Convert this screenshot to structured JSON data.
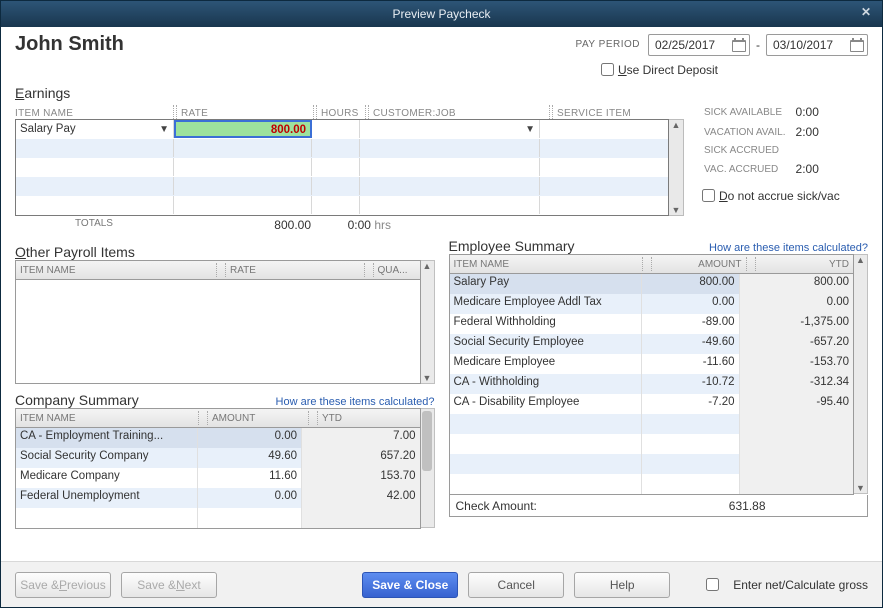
{
  "window": {
    "title": "Preview Paycheck"
  },
  "employee": {
    "name": "John Smith"
  },
  "pay_period": {
    "label": "PAY PERIOD",
    "start": "02/25/2017",
    "to": "-",
    "end": "03/10/2017"
  },
  "direct_deposit": {
    "checked": false,
    "label": "Use Direct Deposit",
    "underline_char": "U"
  },
  "earnings": {
    "title": "Earnings",
    "title_underline": "E",
    "columns": {
      "item": "ITEM NAME",
      "rate": "RATE",
      "hours": "HOURS",
      "customer": "CUSTOMER:JOB",
      "service": "SERVICE ITEM"
    },
    "rows": [
      {
        "item": "Salary Pay",
        "rate": "800.00",
        "hours": "",
        "customer": "",
        "service": ""
      }
    ],
    "totals": {
      "label": "TOTALS",
      "rate": "800.00",
      "hours": "0:00",
      "hrs_suffix": "hrs"
    }
  },
  "side_balances": {
    "sick_available": {
      "label": "SICK AVAILABLE",
      "value": "0:00"
    },
    "vacation_available": {
      "label": "VACATION AVAIL.",
      "value": "2:00"
    },
    "sick_accrued": {
      "label": "SICK ACCRUED",
      "value": ""
    },
    "vacation_accrued": {
      "label": "VAC. ACCRUED",
      "value": "2:00"
    },
    "do_not_accrue": {
      "checked": false,
      "label": "Do not accrue sick/vac",
      "underline_char": "D"
    }
  },
  "other_items": {
    "title": "Other Payroll Items",
    "title_underline": "O",
    "columns": {
      "item": "ITEM NAME",
      "rate": "RATE",
      "qty": "QUA..."
    },
    "rows": []
  },
  "company_summary": {
    "title": "Company Summary",
    "calc_link": "How are these items calculated?",
    "columns": {
      "item": "ITEM NAME",
      "amount": "AMOUNT",
      "ytd": "YTD"
    },
    "rows": [
      {
        "item": "CA - Employment Training...",
        "amount": "0.00",
        "ytd": "7.00"
      },
      {
        "item": "Social Security Company",
        "amount": "49.60",
        "ytd": "657.20"
      },
      {
        "item": "Medicare Company",
        "amount": "11.60",
        "ytd": "153.70"
      },
      {
        "item": "Federal Unemployment",
        "amount": "0.00",
        "ytd": "42.00"
      }
    ]
  },
  "employee_summary": {
    "title": "Employee Summary",
    "calc_link": "How are these items calculated?",
    "columns": {
      "item": "ITEM NAME",
      "amount": "AMOUNT",
      "ytd": "YTD"
    },
    "rows": [
      {
        "item": "Salary Pay",
        "amount": "800.00",
        "ytd": "800.00"
      },
      {
        "item": "Medicare Employee Addl Tax",
        "amount": "0.00",
        "ytd": "0.00"
      },
      {
        "item": "Federal Withholding",
        "amount": "-89.00",
        "ytd": "-1,375.00"
      },
      {
        "item": "Social Security Employee",
        "amount": "-49.60",
        "ytd": "-657.20"
      },
      {
        "item": "Medicare Employee",
        "amount": "-11.60",
        "ytd": "-153.70"
      },
      {
        "item": "CA - Withholding",
        "amount": "-10.72",
        "ytd": "-312.34"
      },
      {
        "item": "CA - Disability Employee",
        "amount": "-7.20",
        "ytd": "-95.40"
      }
    ],
    "check_amount": {
      "label": "Check Amount:",
      "value": "631.88"
    }
  },
  "buttons": {
    "save_prev": "Save & Previous",
    "save_prev_ul": "P",
    "save_next": "Save & Next",
    "save_next_ul": "N",
    "save_close": "Save & Close",
    "cancel": "Cancel",
    "help": "Help",
    "enter_net": "Enter net/Calculate gross",
    "enter_net_ul": "g"
  }
}
